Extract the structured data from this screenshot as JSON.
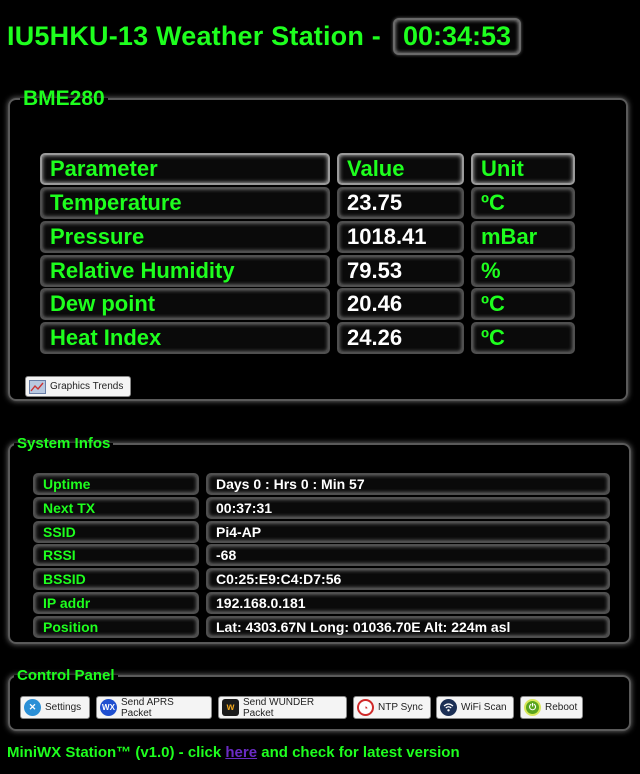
{
  "header": {
    "title": "IU5HKU-13 Weather Station -",
    "clock": "00:34:53"
  },
  "bme": {
    "legend": "BME280",
    "columns": [
      "Parameter",
      "Value",
      "Unit"
    ],
    "rows": [
      {
        "param": "Temperature",
        "value": "23.75",
        "unit": "ºC"
      },
      {
        "param": "Pressure",
        "value": "1018.41",
        "unit": "mBar"
      },
      {
        "param": "Relative Humidity",
        "value": "79.53",
        "unit": "%"
      },
      {
        "param": "Dew point",
        "value": "20.46",
        "unit": "ºC"
      },
      {
        "param": "Heat Index",
        "value": "24.26",
        "unit": "ºC"
      }
    ],
    "graphics_button": "Graphics Trends"
  },
  "system": {
    "legend": "System Infos",
    "rows": [
      {
        "label": "Uptime",
        "value": "Days 0 : Hrs 0 : Min 57"
      },
      {
        "label": "Next TX",
        "value": "00:37:31"
      },
      {
        "label": "SSID",
        "value": "Pi4-AP"
      },
      {
        "label": "RSSI",
        "value": "-68"
      },
      {
        "label": "BSSID",
        "value": "C0:25:E9:C4:D7:56"
      },
      {
        "label": "IP addr",
        "value": "192.168.0.181"
      },
      {
        "label": "Position",
        "value": "Lat: 4303.67N Long: 01036.70E Alt: 224m asl"
      }
    ]
  },
  "control": {
    "legend": "Control Panel",
    "buttons": [
      {
        "label": "Settings",
        "icon": "wrench-icon",
        "color": "#2a8fd6"
      },
      {
        "label": "Send APRS Packet",
        "icon": "wx-icon",
        "color": "#1f4fd0"
      },
      {
        "label": "Send WUNDER Packet",
        "icon": "wunderground-icon",
        "color": "#1b1b1b"
      },
      {
        "label": "NTP Sync",
        "icon": "clock-icon",
        "color": "#d02a2a"
      },
      {
        "label": "WiFi Scan",
        "icon": "wifi-icon",
        "color": "#1b2f55"
      },
      {
        "label": "Reboot",
        "icon": "power-icon",
        "color": "#5aa51e"
      }
    ]
  },
  "footer": {
    "prefix": "MiniWX Station™ (v1.0) - click ",
    "link": "here",
    "suffix": " and check for latest version"
  }
}
